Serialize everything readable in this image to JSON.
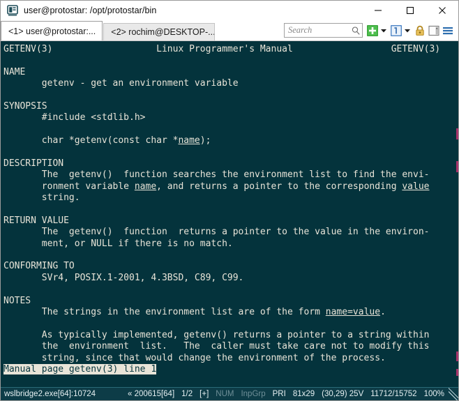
{
  "window": {
    "title": "user@protostar: /opt/protostar/bin",
    "app_icon": "console-icon",
    "minimize_label": "Minimize",
    "maximize_label": "Maximize",
    "close_label": "Close"
  },
  "tabs": [
    {
      "label": "<1> user@protostar:...",
      "active": true
    },
    {
      "label": "<2> rochim@DESKTOP-...",
      "active": false
    }
  ],
  "toolbar": {
    "search": {
      "value": "",
      "placeholder": "Search"
    },
    "new_tab_label": "New console",
    "new_tab_caret_label": "New console menu",
    "active_console_label": "1",
    "active_console_caret_label": "Console list menu",
    "lock_label": "Lock",
    "panels_label": "Toggle panels",
    "menu_label": "Main menu"
  },
  "terminal": {
    "background": "#04333c",
    "foreground": "#e8e4d8",
    "lines": [
      {
        "segments": [
          {
            "t": "GETENV(3)                   Linux Programmer's Manual                  GETENV(3)"
          }
        ]
      },
      {
        "segments": [
          {
            "t": ""
          }
        ]
      },
      {
        "segments": [
          {
            "t": "NAME"
          }
        ]
      },
      {
        "segments": [
          {
            "t": "       getenv - get an environment variable"
          }
        ]
      },
      {
        "segments": [
          {
            "t": ""
          }
        ]
      },
      {
        "segments": [
          {
            "t": "SYNOPSIS"
          }
        ]
      },
      {
        "segments": [
          {
            "t": "       #include <stdlib.h>"
          }
        ]
      },
      {
        "segments": [
          {
            "t": ""
          }
        ]
      },
      {
        "segments": [
          {
            "t": "       char *getenv(const char *"
          },
          {
            "t": "name",
            "style": "u"
          },
          {
            "t": ");"
          }
        ]
      },
      {
        "segments": [
          {
            "t": ""
          }
        ]
      },
      {
        "segments": [
          {
            "t": "DESCRIPTION"
          }
        ]
      },
      {
        "segments": [
          {
            "t": "       The  getenv()  function searches the environment list to find the envi-"
          }
        ]
      },
      {
        "segments": [
          {
            "t": "       ronment variable "
          },
          {
            "t": "name",
            "style": "u"
          },
          {
            "t": ", and returns a pointer to the corresponding "
          },
          {
            "t": "value",
            "style": "u"
          }
        ]
      },
      {
        "segments": [
          {
            "t": "       string."
          }
        ]
      },
      {
        "segments": [
          {
            "t": ""
          }
        ]
      },
      {
        "segments": [
          {
            "t": "RETURN VALUE"
          }
        ]
      },
      {
        "segments": [
          {
            "t": "       The  getenv()  function  returns a pointer to the value in the environ-"
          }
        ]
      },
      {
        "segments": [
          {
            "t": "       ment, or NULL if there is no match."
          }
        ]
      },
      {
        "segments": [
          {
            "t": ""
          }
        ]
      },
      {
        "segments": [
          {
            "t": "CONFORMING TO"
          }
        ]
      },
      {
        "segments": [
          {
            "t": "       SVr4, POSIX.1-2001, 4.3BSD, C89, C99."
          }
        ]
      },
      {
        "segments": [
          {
            "t": ""
          }
        ]
      },
      {
        "segments": [
          {
            "t": "NOTES"
          }
        ]
      },
      {
        "segments": [
          {
            "t": "       The strings in the environment list are of the form "
          },
          {
            "t": "name=value",
            "style": "u"
          },
          {
            "t": "."
          }
        ]
      },
      {
        "segments": [
          {
            "t": ""
          }
        ]
      },
      {
        "segments": [
          {
            "t": "       As typically implemented, getenv() returns a pointer to a string within"
          }
        ]
      },
      {
        "segments": [
          {
            "t": "       the  environment  list.   The  caller must take care not to modify this"
          }
        ]
      },
      {
        "segments": [
          {
            "t": "       string, since that would change the environment of the process."
          }
        ]
      },
      {
        "segments": [
          {
            "t": ""
          },
          {
            "t": "Manual page getenv(3) line 1",
            "style": "inverse"
          }
        ]
      }
    ],
    "pager_status": "Manual page getenv(3) line 1"
  },
  "statusbar": {
    "process": "wslbridge2.exe[64]:10724",
    "version": "« 200615[64]",
    "tab_count": "1/2",
    "plus": "[+]",
    "num_lock": "NUM",
    "input_group": "InpGrp",
    "priority": "PRI",
    "size": "81x29",
    "cursor": "(30,29) 25V",
    "buffer": "11712/15752",
    "zoom": "100%"
  }
}
